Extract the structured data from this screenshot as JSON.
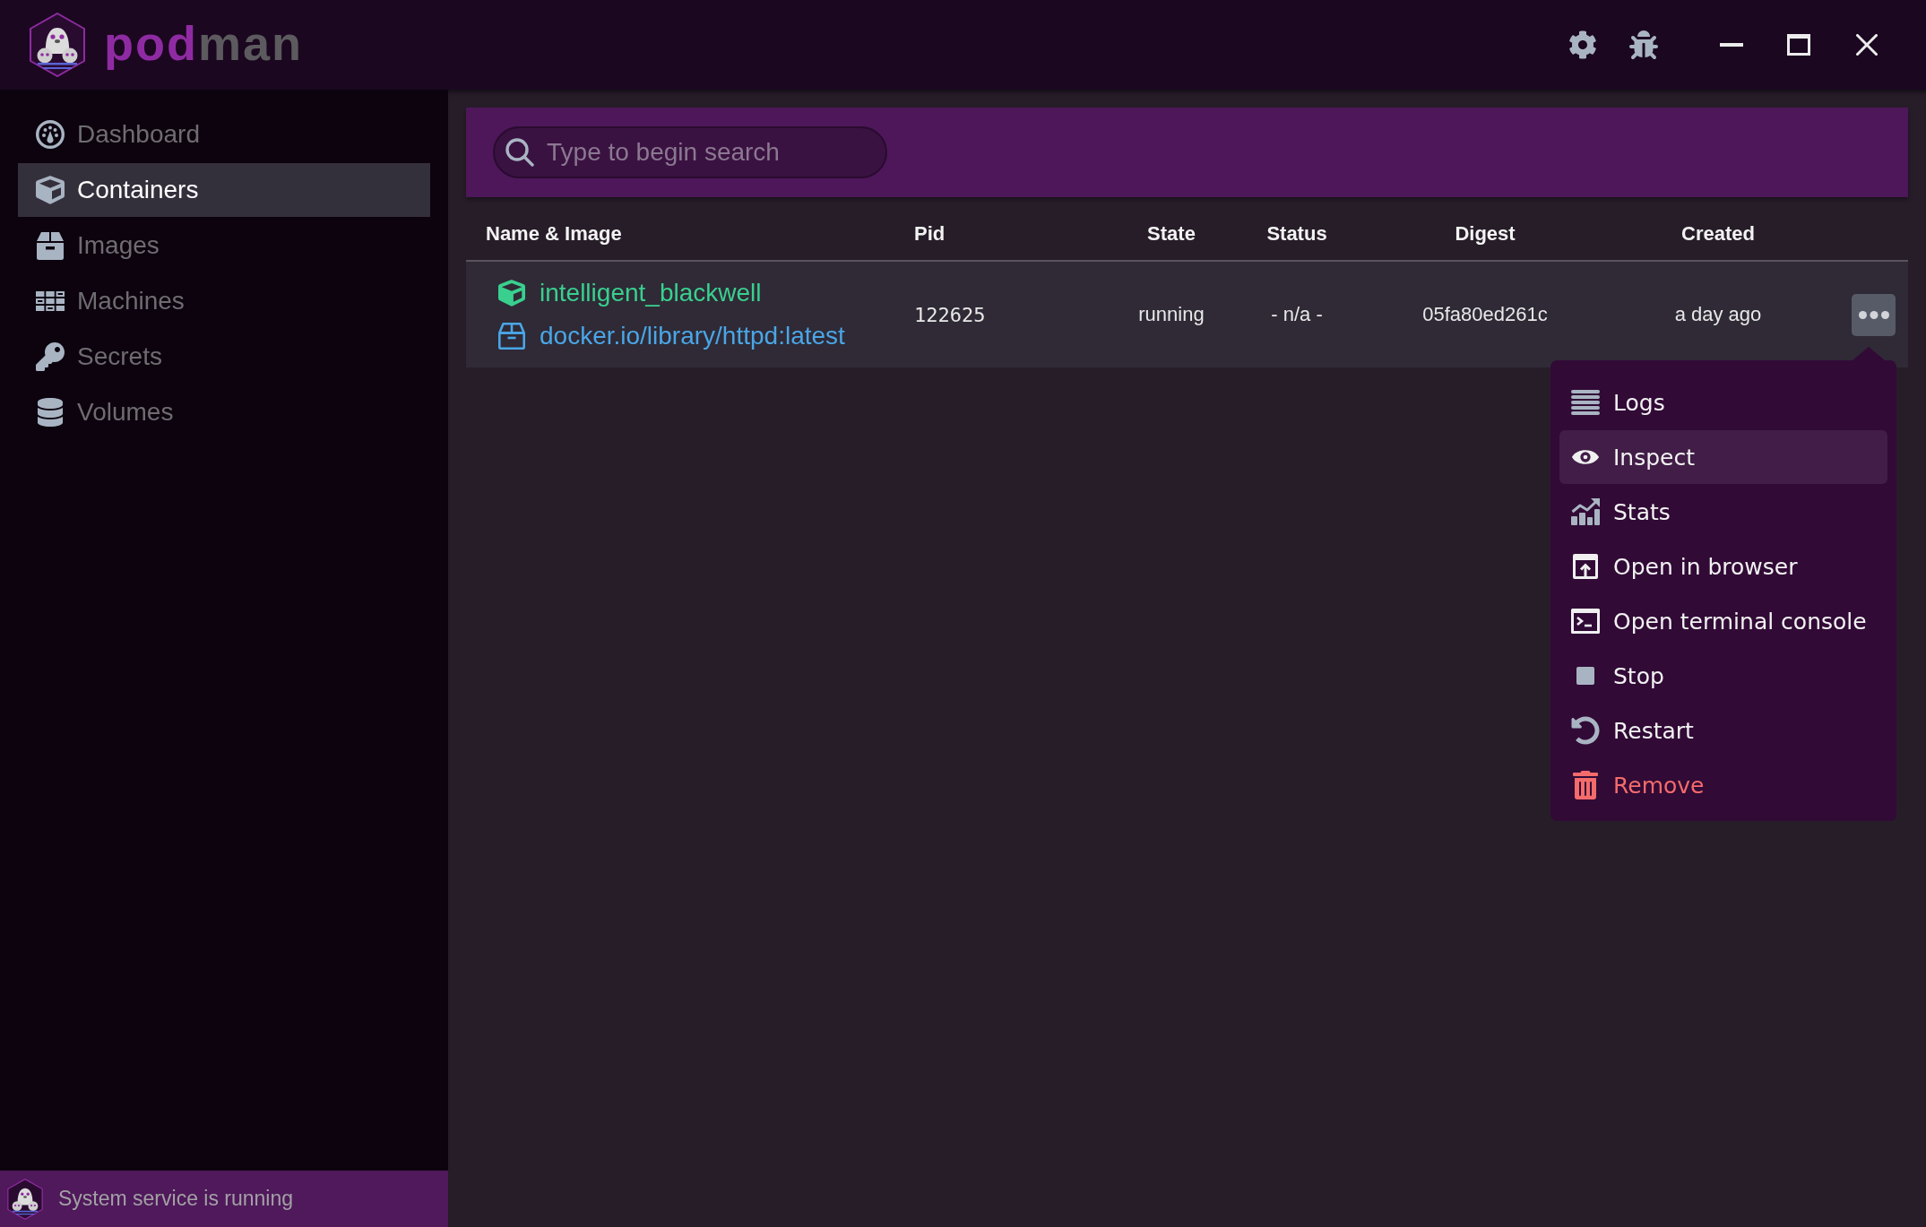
{
  "title_bar": {
    "brand": [
      {
        "text": "pod",
        "color": "#8f2ba2"
      },
      {
        "text": "man",
        "color": "#5c5a5e"
      }
    ]
  },
  "sidebar": {
    "items": [
      {
        "label": "Dashboard",
        "selected": false
      },
      {
        "label": "Containers",
        "selected": true
      },
      {
        "label": "Images",
        "selected": false
      },
      {
        "label": "Machines",
        "selected": false
      },
      {
        "label": "Secrets",
        "selected": false
      },
      {
        "label": "Volumes",
        "selected": false
      }
    ]
  },
  "status_bar": {
    "text": "System service is running"
  },
  "search": {
    "placeholder": "Type to begin search"
  },
  "table": {
    "columns": [
      "Name & Image",
      "Pid",
      "State",
      "Status",
      "Digest",
      "Created"
    ],
    "rows": [
      {
        "name": "intelligent_blackwell",
        "image": "docker.io/library/httpd:latest",
        "pid": "122625",
        "state": "running",
        "status": "- n/a -",
        "digest": "05fa80ed261c",
        "created": "a day ago"
      }
    ]
  },
  "context_menu": {
    "items": [
      {
        "label": "Logs",
        "kind": "default",
        "selected": false
      },
      {
        "label": "Inspect",
        "kind": "default",
        "selected": true
      },
      {
        "label": "Stats",
        "kind": "default",
        "selected": false
      },
      {
        "label": "Open in browser",
        "kind": "default",
        "selected": false
      },
      {
        "label": "Open terminal console",
        "kind": "default",
        "selected": false
      },
      {
        "label": "Stop",
        "kind": "default",
        "selected": false
      },
      {
        "label": "Restart",
        "kind": "default",
        "selected": false
      },
      {
        "label": "Remove",
        "kind": "destructive",
        "selected": false
      }
    ]
  }
}
